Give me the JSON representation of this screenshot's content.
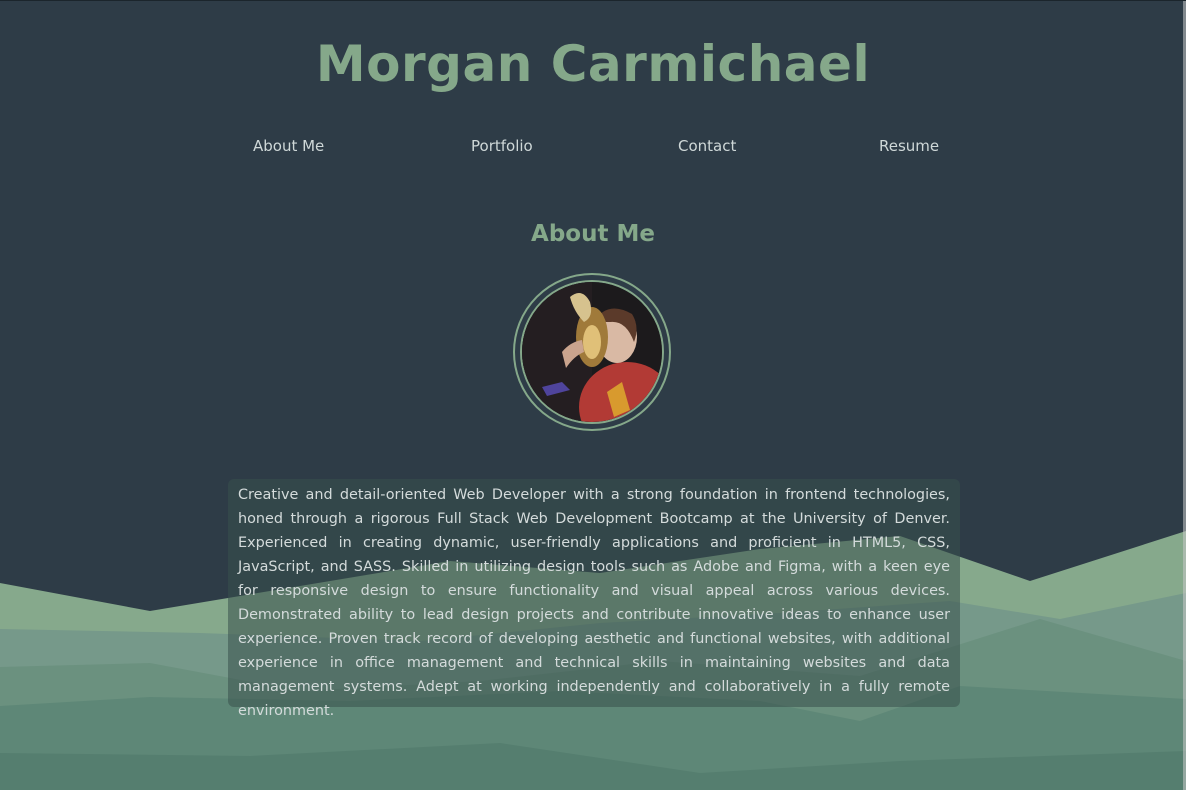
{
  "header": {
    "title": "Morgan Carmichael"
  },
  "nav": {
    "items": [
      "About Me",
      "Portfolio",
      "Contact",
      "Resume"
    ]
  },
  "about": {
    "heading": "About Me",
    "photo_alt": "profile-photo",
    "bio": "Creative and detail-oriented Web Developer with a strong foundation in frontend technologies, honed through a rigorous Full Stack Web Development Bootcamp at the University of Denver. Experienced in creating dynamic, user-friendly applications and proficient in HTML5, CSS, JavaScript, and SASS. Skilled in utilizing design tools such as Adobe and Figma, with a keen eye for responsive design to ensure functionality and visual appeal across various devices. Demonstrated ability to lead design projects and contribute innovative ideas to enhance user experience. Proven track record of developing aesthetic and functional websites, with additional experience in office management and technical skills in maintaining websites and data management systems. Adept at working independently and collaboratively in a fully remote environment."
  },
  "colors": {
    "background": "#2e3c47",
    "accent": "#85a88a",
    "text": "#d4dbdb"
  }
}
